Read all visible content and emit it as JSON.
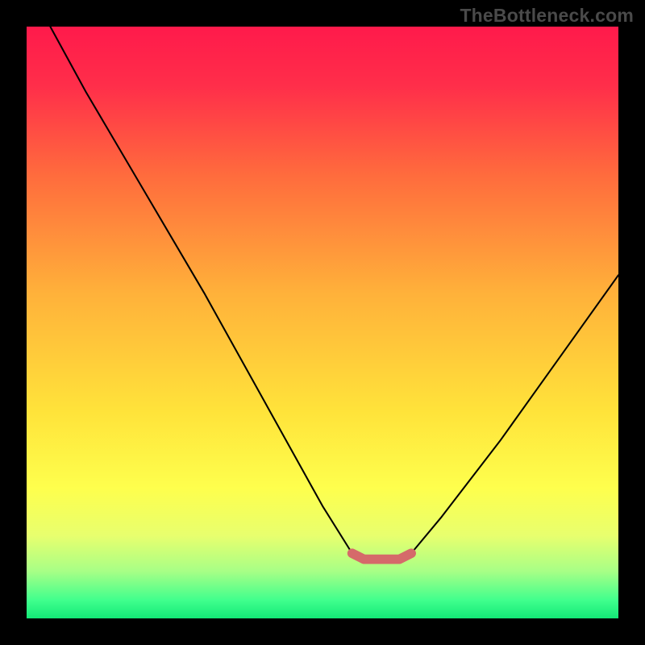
{
  "watermark": "TheBottleneck.com",
  "chart_data": {
    "type": "line",
    "title": "",
    "xlabel": "",
    "ylabel": "",
    "xlim": [
      0,
      100
    ],
    "ylim": [
      0,
      100
    ],
    "grid": false,
    "legend": false,
    "annotations": [],
    "series": [
      {
        "name": "bottleneck-curve",
        "color": "#000000",
        "x": [
          4,
          10,
          20,
          30,
          40,
          50,
          55,
          57,
          60,
          63,
          65,
          70,
          80,
          90,
          100
        ],
        "values": [
          100,
          89,
          72,
          55,
          37,
          19,
          11,
          10,
          10,
          10,
          11,
          17,
          30,
          44,
          58
        ]
      },
      {
        "name": "optimal-zone-marker",
        "color": "#d56a6a",
        "x": [
          55,
          57,
          60,
          63,
          65
        ],
        "values": [
          11,
          10,
          10,
          10,
          11
        ]
      }
    ],
    "gradient_stops": [
      {
        "offset": 0.0,
        "color": "#ff1a4b"
      },
      {
        "offset": 0.1,
        "color": "#ff2e4a"
      },
      {
        "offset": 0.25,
        "color": "#ff6b3d"
      },
      {
        "offset": 0.45,
        "color": "#ffb13a"
      },
      {
        "offset": 0.65,
        "color": "#ffe33a"
      },
      {
        "offset": 0.78,
        "color": "#feff4d"
      },
      {
        "offset": 0.86,
        "color": "#e8ff6e"
      },
      {
        "offset": 0.92,
        "color": "#a8ff86"
      },
      {
        "offset": 0.97,
        "color": "#3fff8d"
      },
      {
        "offset": 1.0,
        "color": "#13e876"
      }
    ]
  }
}
